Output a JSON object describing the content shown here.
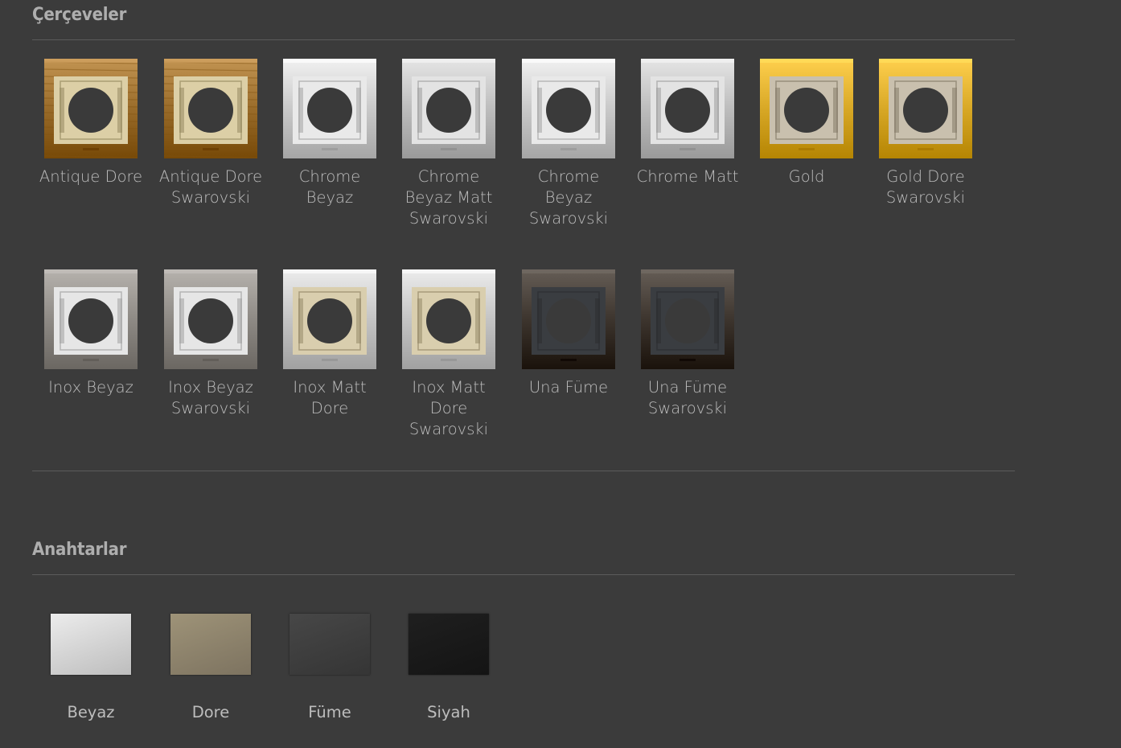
{
  "frames_section": {
    "title": "Çerçeveler",
    "items": [
      {
        "label": "Antique Dore",
        "frame": "#9a6c2a",
        "plate": "#dccfa6",
        "style": "antique"
      },
      {
        "label": "Antique Dore\nSwarovski",
        "frame": "#9a6c2a",
        "plate": "#dccfa6",
        "style": "antique"
      },
      {
        "label": "Chrome\nBeyaz",
        "frame": "#c9c9c9",
        "plate": "#e9e9e9",
        "style": "chrome"
      },
      {
        "label": "Chrome\nBeyaz Matt\nSwarovski",
        "frame": "#bdbdbd",
        "plate": "#e3e3e3",
        "style": "matt"
      },
      {
        "label": "Chrome\nBeyaz\nSwarovski",
        "frame": "#c9c9c9",
        "plate": "#e9e9e9",
        "style": "chrome"
      },
      {
        "label": "Chrome Matt",
        "frame": "#bdbdbd",
        "plate": "#e3e3e3",
        "style": "matt"
      },
      {
        "label": "Gold",
        "frame": "#d8a826",
        "plate": "#c9c0ae",
        "style": "gold"
      },
      {
        "label": "Gold Dore\nSwarovski",
        "frame": "#d8a826",
        "plate": "#c9c0ae",
        "style": "gold"
      },
      {
        "label": "Inox Beyaz",
        "frame": "#8e8a85",
        "plate": "#e6e6e6",
        "style": "inox"
      },
      {
        "label": "Inox Beyaz\nSwarovski",
        "frame": "#8e8a85",
        "plate": "#e6e6e6",
        "style": "inox"
      },
      {
        "label": "Inox Matt\nDore",
        "frame": "#c4c4c4",
        "plate": "#d9ceae",
        "style": "inoxmatt"
      },
      {
        "label": "Inox Matt\nDore\nSwarovski",
        "frame": "#c4c4c4",
        "plate": "#d9ceae",
        "style": "inoxmatt"
      },
      {
        "label": "Una Füme",
        "frame": "#3d352e",
        "plate": "#3a3d41",
        "style": "una"
      },
      {
        "label": "Una Füme\nSwarovski",
        "frame": "#3d352e",
        "plate": "#3a3d41",
        "style": "una"
      }
    ]
  },
  "switches_section": {
    "title": "Anahtarlar",
    "items": [
      {
        "label": "Beyaz",
        "color_top": "#ececec",
        "color_bottom": "#bdbdbd"
      },
      {
        "label": "Dore",
        "color_top": "#9e9378",
        "color_bottom": "#7d7360"
      },
      {
        "label": "Füme",
        "color_top": "#474747",
        "color_bottom": "#353535"
      },
      {
        "label": "Siyah",
        "color_top": "#1f1f1f",
        "color_bottom": "#141414"
      }
    ]
  }
}
